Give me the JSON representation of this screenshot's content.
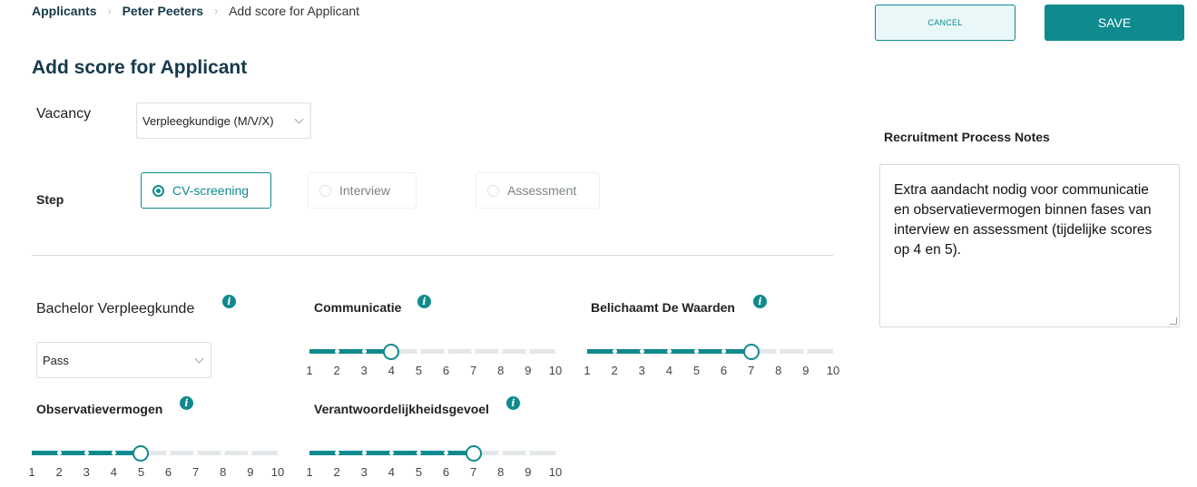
{
  "breadcrumb": {
    "items": [
      "Applicants",
      "Peter Peeters",
      "Add score for Applicant"
    ]
  },
  "page_title": "Add score for Applicant",
  "actions": {
    "cancel_label": "CANCEL",
    "save_label": "SAVE"
  },
  "vacancy": {
    "label": "Vacancy",
    "selected": "Verpleegkundige (M/V/X)"
  },
  "step": {
    "label": "Step",
    "options": [
      "CV-screening",
      "Interview",
      "Assessment"
    ],
    "selected": "CV-screening"
  },
  "criteria": [
    {
      "label": "Bachelor Verpleegkunde",
      "type": "select",
      "value": "Pass"
    },
    {
      "label": "Communicatie",
      "type": "slider",
      "value": 4,
      "min": 1,
      "max": 10
    },
    {
      "label": "Belichaamt De Waarden",
      "type": "slider",
      "value": 7,
      "min": 1,
      "max": 10
    },
    {
      "label": "Observatievermogen",
      "type": "slider",
      "value": 5,
      "min": 1,
      "max": 10
    },
    {
      "label": "Verantwoordelijkheidsgevoel",
      "type": "slider",
      "value": 7,
      "min": 1,
      "max": 10
    }
  ],
  "info_icon_glyph": "i",
  "notes": {
    "label": "Recruitment Process Notes",
    "text": "Extra aandacht nodig voor communicatie en observatievermogen binnen fases van interview en assessment (tijdelijke scores op 4 en 5)."
  },
  "colors": {
    "accent": "#0f8a8e",
    "title": "#143a4a",
    "track": "#e4e7ea"
  }
}
